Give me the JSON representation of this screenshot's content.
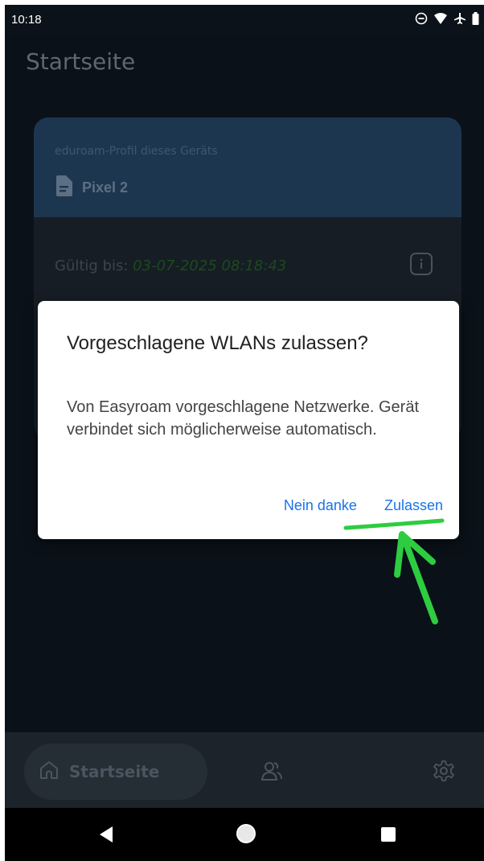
{
  "status_bar": {
    "time": "10:18",
    "icons": [
      "do-not-disturb-icon",
      "wifi-icon",
      "airplane-mode-icon",
      "battery-icon"
    ]
  },
  "page": {
    "title": "Startseite"
  },
  "profile_card": {
    "caption": "eduroam-Profil dieses Geräts",
    "device_icon": "document-icon",
    "device_name": "Pixel 2",
    "valid_label": "Gültig bis:",
    "valid_until": "03-07-2025 08:18:43",
    "info_icon": "info-icon"
  },
  "dialog": {
    "title": "Vorgeschlagene WLANs zulassen?",
    "message": "Von Easyroam vorgeschlagene Netzwerke. Gerät verbindet sich möglicherweise automatisch.",
    "decline_label": "Nein danke",
    "allow_label": "Zulassen"
  },
  "annotation": {
    "color": "#2ecc40",
    "target": "allow_button"
  },
  "bottom_nav": {
    "home_label": "Startseite",
    "items": [
      "home-icon",
      "people-icon",
      "gear-icon"
    ]
  },
  "system_nav": {
    "items": [
      "back-icon",
      "home-circle-icon",
      "recents-icon"
    ]
  },
  "colors": {
    "background": "#0a1118",
    "card_header": "#1d3650",
    "dialog_button": "#1a73e8"
  }
}
